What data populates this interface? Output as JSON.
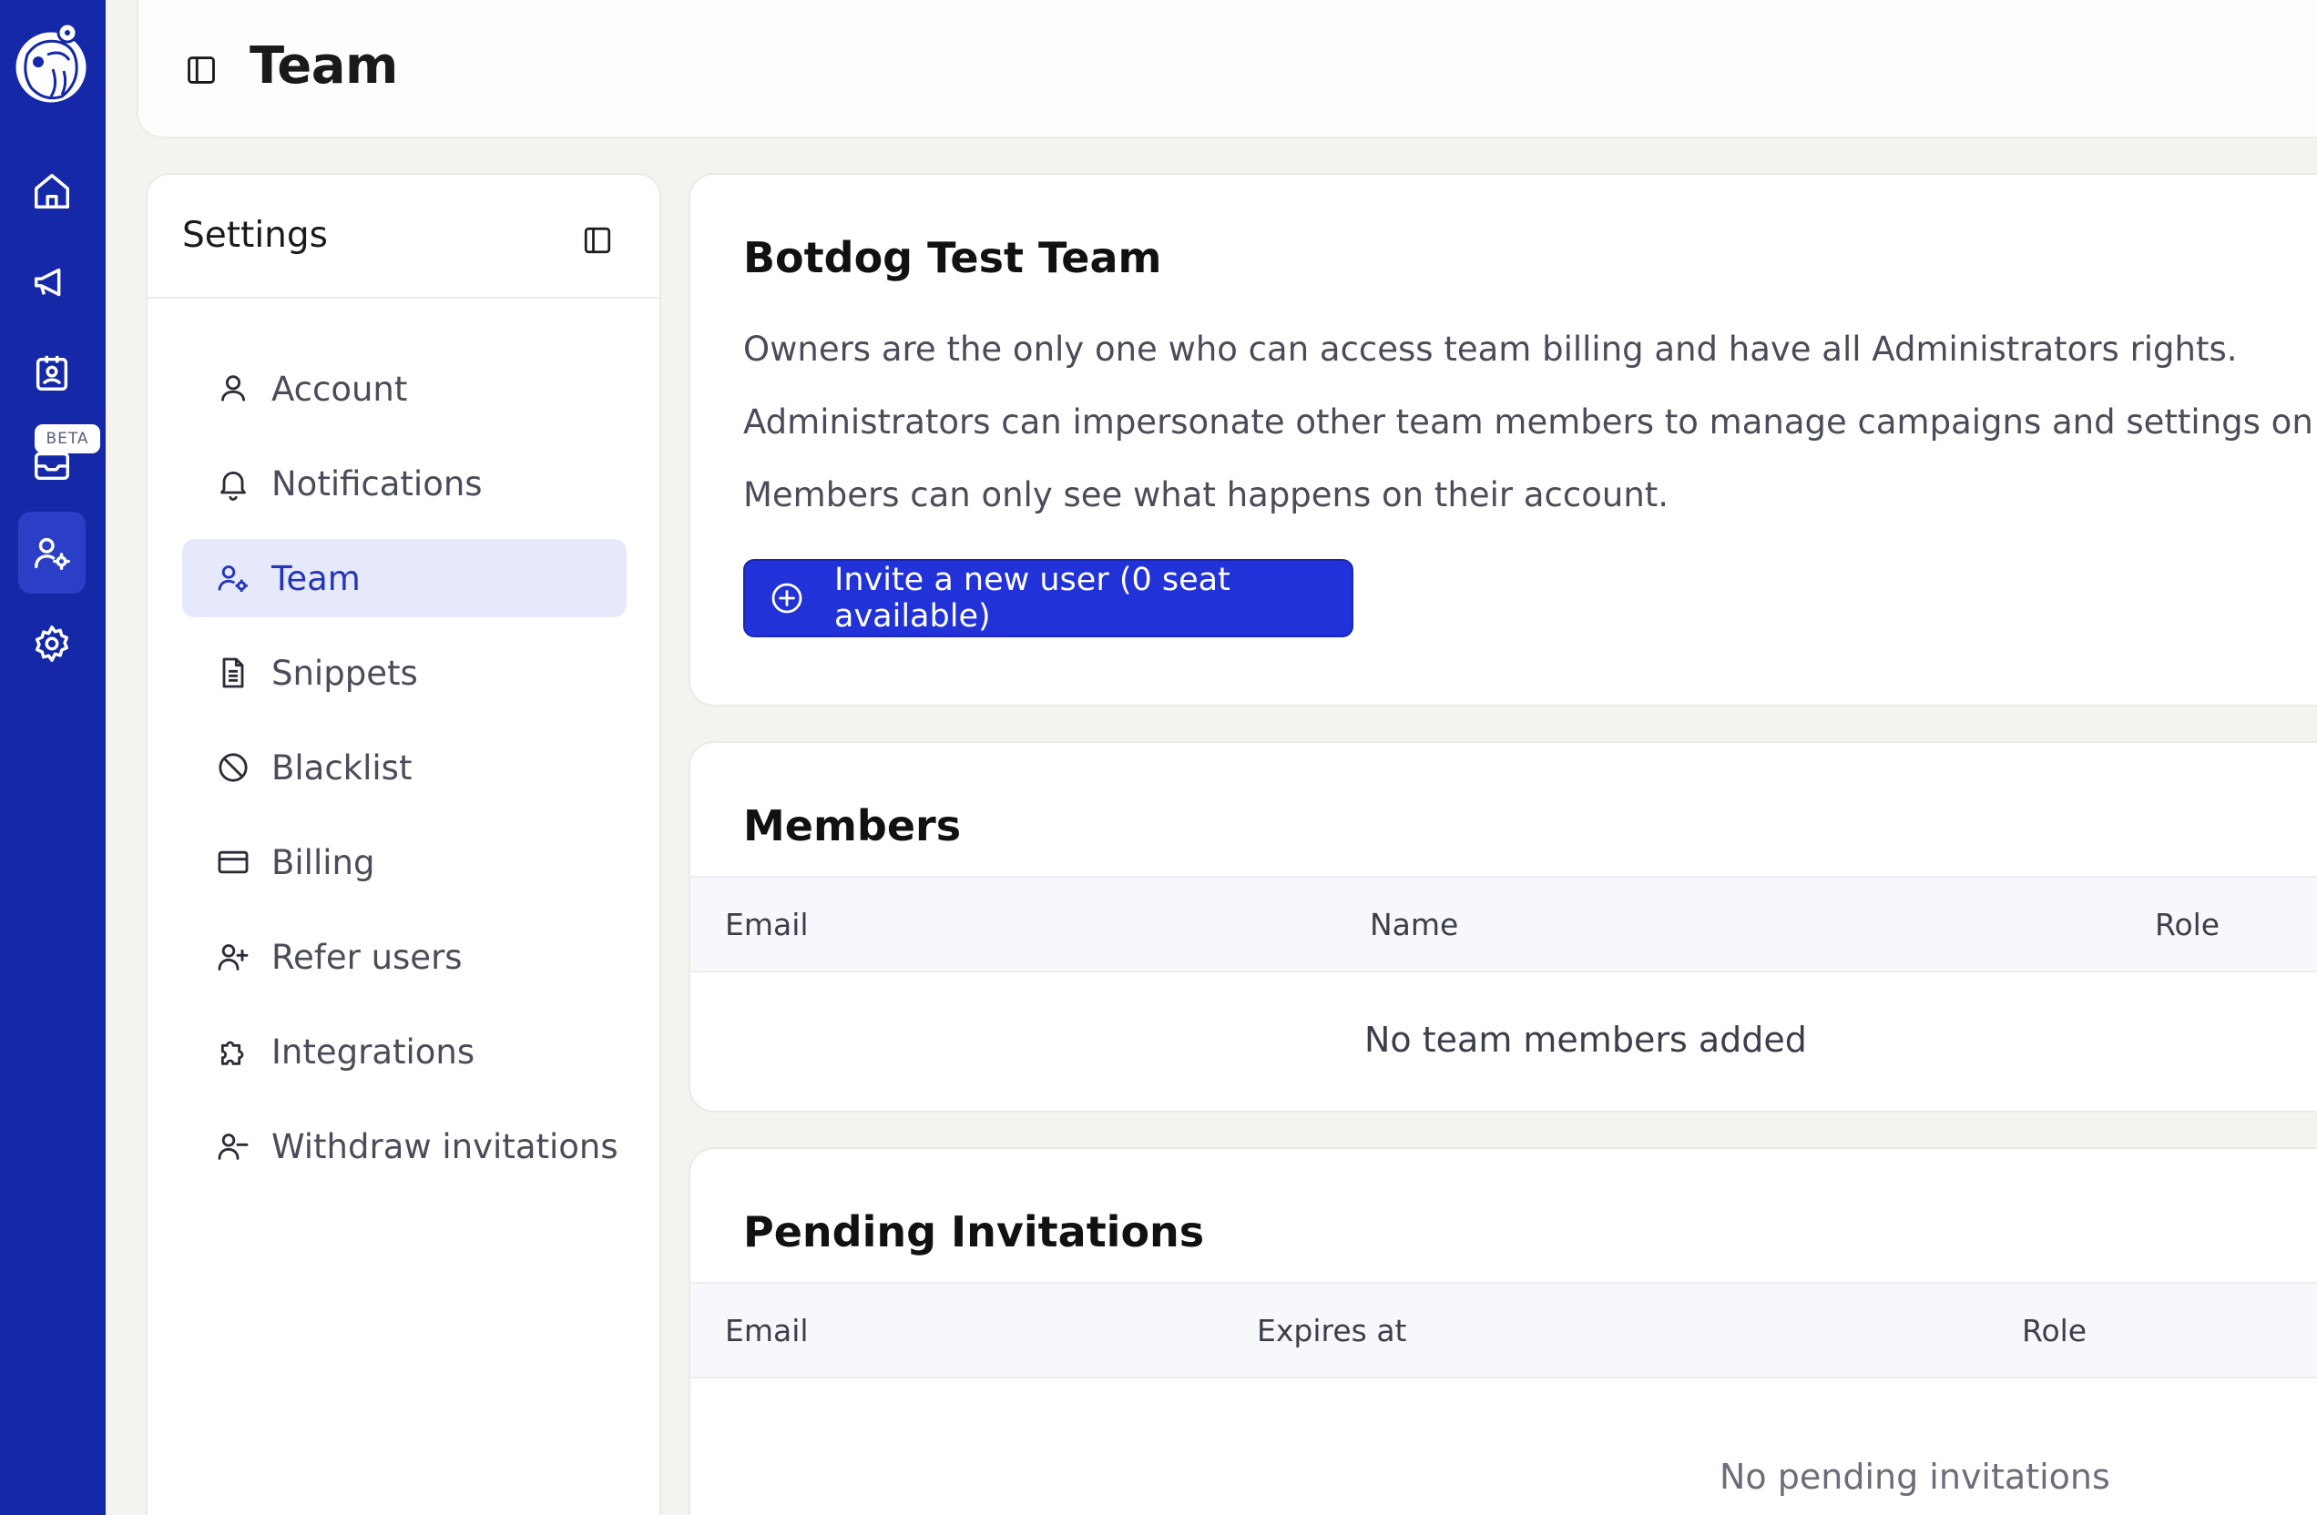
{
  "rail": {
    "items": [
      {
        "name": "home-icon"
      },
      {
        "name": "megaphone-icon"
      },
      {
        "name": "contact-badge-icon"
      },
      {
        "name": "inbox-icon"
      },
      {
        "name": "team-settings-icon"
      },
      {
        "name": "gear-icon"
      }
    ],
    "beta_label": "BETA",
    "accent": "#1428a8"
  },
  "header": {
    "title": "Team"
  },
  "settings": {
    "title": "Settings",
    "items": [
      {
        "label": "Account",
        "icon": "user-icon"
      },
      {
        "label": "Notifications",
        "icon": "bell-icon"
      },
      {
        "label": "Team",
        "icon": "user-gear-icon",
        "active": true
      },
      {
        "label": "Snippets",
        "icon": "document-icon"
      },
      {
        "label": "Blacklist",
        "icon": "ban-icon"
      },
      {
        "label": "Billing",
        "icon": "credit-card-icon"
      },
      {
        "label": "Refer users",
        "icon": "user-plus-icon"
      },
      {
        "label": "Integrations",
        "icon": "puzzle-icon"
      },
      {
        "label": "Withdraw invitations",
        "icon": "user-minus-icon"
      }
    ]
  },
  "team": {
    "name": "Botdog Test Team",
    "descriptions": [
      "Owners are the only one who can access team billing and have all Administrators rights.",
      "Administrators can impersonate other team members to manage campaigns and settings on their l",
      "Members can only see what happens on their account."
    ],
    "invite_button": "Invite a new user (0 seat available)",
    "button_color": "#2232d9"
  },
  "members": {
    "title": "Members",
    "columns": [
      "Email",
      "Name",
      "Role"
    ],
    "empty_text": "No team members added"
  },
  "invitations": {
    "title": "Pending Invitations",
    "columns": [
      "Email",
      "Expires at",
      "Role"
    ],
    "empty_text": "No pending invitations"
  }
}
